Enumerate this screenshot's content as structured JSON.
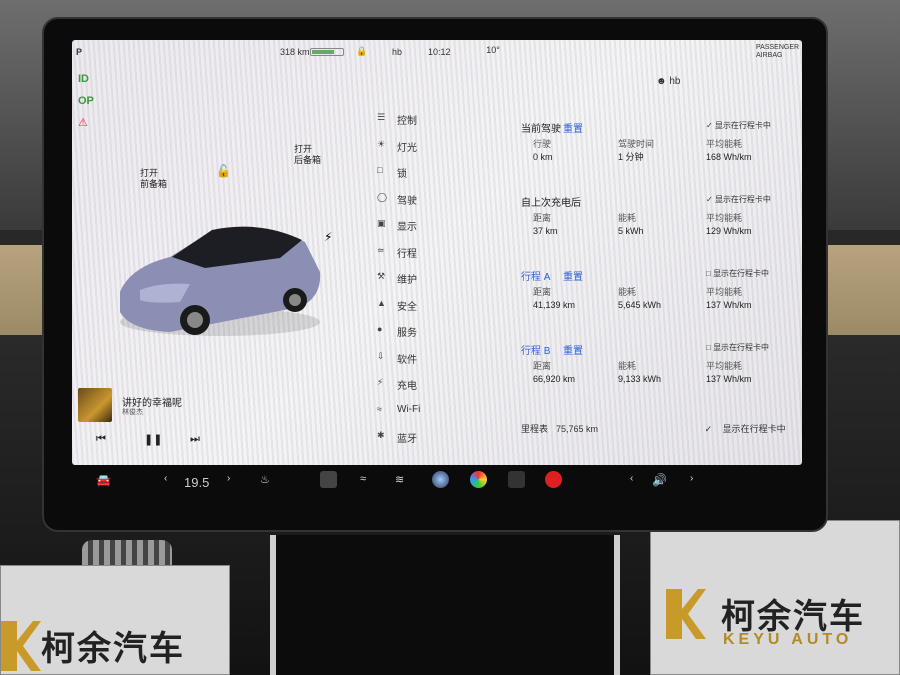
{
  "status_bar": {
    "gear": "P",
    "range": "318 km",
    "user": "hb",
    "time": "10:12",
    "outside_temp": "10°",
    "airbag_text": "PASSENGER AIRBAG"
  },
  "telltales": [
    "ID",
    "OP"
  ],
  "trunk": {
    "front_open": "打开",
    "front_label": "前备箱",
    "rear_open": "打开",
    "rear_label": "后备箱"
  },
  "media": {
    "song": "讲好的幸福呢",
    "artist": "林俊杰"
  },
  "menu": {
    "items": [
      {
        "label": "控制"
      },
      {
        "label": "灯光"
      },
      {
        "label": "锁"
      },
      {
        "label": "驾驶"
      },
      {
        "label": "显示"
      },
      {
        "label": "行程"
      },
      {
        "label": "维护"
      },
      {
        "label": "安全"
      },
      {
        "label": "服务"
      },
      {
        "label": "软件"
      },
      {
        "label": "充电"
      },
      {
        "label": "Wi-Fi"
      },
      {
        "label": "蓝牙"
      }
    ]
  },
  "profile": {
    "user": "hb"
  },
  "trip": {
    "current": {
      "title": "当前驾驶",
      "link": "重置",
      "cols": [
        {
          "label": "行驶",
          "value": "0 km"
        },
        {
          "label": "驾驶时间",
          "value": "1 分钟"
        },
        {
          "label": "平均能耗",
          "value": "168 Wh/km"
        }
      ]
    },
    "since_charge": {
      "title": "自上次充电后",
      "cols": [
        {
          "label": "距离",
          "value": "37 km"
        },
        {
          "label": "能耗",
          "value": "5 kWh"
        },
        {
          "label": "平均能耗",
          "value": "129 Wh/km"
        }
      ]
    },
    "trip_a": {
      "title": "行程 A",
      "link": "重置",
      "cols": [
        {
          "label": "距离",
          "value": "41,139 km"
        },
        {
          "label": "能耗",
          "value": "5,645 kWh"
        },
        {
          "label": "平均能耗",
          "value": "137 Wh/km"
        }
      ]
    },
    "trip_b": {
      "title": "行程 B",
      "link": "重置",
      "cols": [
        {
          "label": "距离",
          "value": "66,920 km"
        },
        {
          "label": "能耗",
          "value": "9,133 kWh"
        },
        {
          "label": "平均能耗",
          "value": "137 Wh/km"
        }
      ]
    },
    "checkbox_label": "显示在行程卡中",
    "odometer_label": "里程表",
    "odometer_value": "75,765 km"
  },
  "taskbar": {
    "cabin_temp": "19.5"
  },
  "signs": {
    "dealer": "柯余汽车",
    "dealer_en": "KEYU AUTO"
  }
}
